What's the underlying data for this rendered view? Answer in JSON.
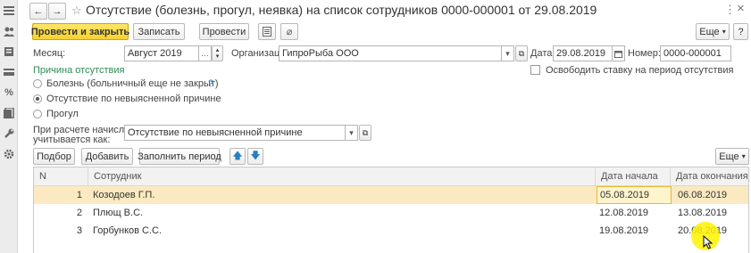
{
  "window": {
    "title": "Отсутствие (болезнь, прогул, неявка) на список сотрудников 0000-000001 от 29.08.2019",
    "star_icon": "☆",
    "more_icon": "⋮",
    "close_icon": "×"
  },
  "toolbar": {
    "post_close": "Провести и закрыть",
    "save": "Записать",
    "post": "Провести",
    "more": "Еще",
    "help": "?"
  },
  "header": {
    "month_label": "Месяц:",
    "month_value": "Август 2019",
    "org_label": "Организация:",
    "org_value": "ГипроРыба ООО",
    "date_label": "Дата:",
    "date_value": "29.08.2019",
    "number_label": "Номер:",
    "number_value": "0000-000001",
    "free_rate_label": "Освободить ставку на период отсутствия"
  },
  "reason": {
    "title": "Причина отсутствия",
    "options": [
      "Болезнь (больничный еще не закрыт)",
      "Отсутствие по невыясненной причине",
      "Прогул"
    ],
    "selected_index": 1,
    "hint": "?"
  },
  "accrual": {
    "label_line1": "При расчете начислений",
    "label_line2": "учитывается как:",
    "value": "Отсутствие по невыясненной причине"
  },
  "table_toolbar": {
    "pick": "Подбор",
    "add": "Добавить",
    "fill_period": "Заполнить период",
    "more": "Еще"
  },
  "table": {
    "columns": [
      "N",
      "Сотрудник",
      "Дата начала",
      "Дата окончания"
    ],
    "rows": [
      {
        "n": "1",
        "employee": "Козодоев Г.П.",
        "start": "05.08.2019",
        "end": "06.08.2019"
      },
      {
        "n": "2",
        "employee": "Плющ В.С.",
        "start": "12.08.2019",
        "end": "13.08.2019"
      },
      {
        "n": "3",
        "employee": "Горбунков С.С.",
        "start": "19.08.2019",
        "end": "20.08.2019"
      }
    ]
  },
  "colors": {
    "primary_button": "#f6d32c",
    "selected_row": "#fbeac1",
    "reason_title": "#2e8b57",
    "highlight_cursor": "#fff200"
  }
}
